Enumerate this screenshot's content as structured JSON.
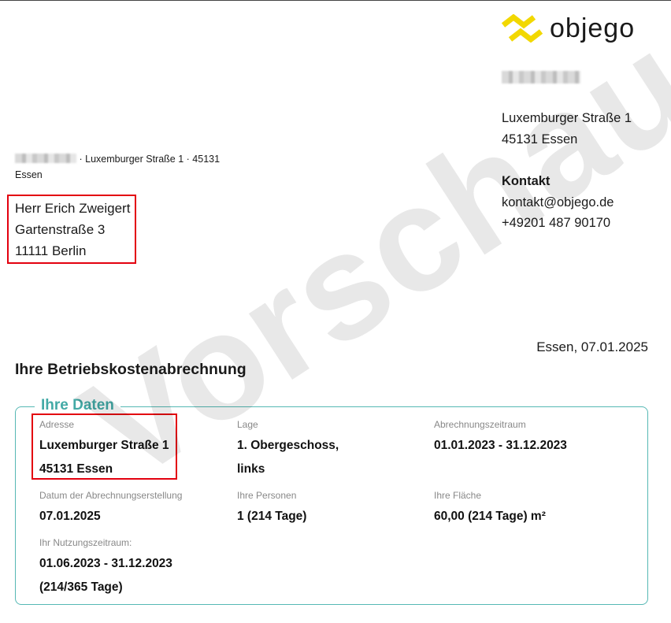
{
  "logo": {
    "text": "objego",
    "color": "#f2d800"
  },
  "sender": {
    "street": "Luxemburger Straße 1",
    "city": "45131 Essen",
    "contact_heading": "Kontakt",
    "email": "kontakt@objego.de",
    "phone": "+49201 487 90170"
  },
  "return_address": {
    "text": "· Luxemburger Straße 1 · 45131",
    "city": "Essen"
  },
  "recipient": {
    "name": "Herr Erich Zweigert",
    "street": "Gartenstraße 3",
    "city": "11111 Berlin"
  },
  "date_line": "Essen, 07.01.2025",
  "title": "Ihre Betriebskostenabrechnung",
  "panel": {
    "title": "Ihre Daten",
    "accent_color": "#43aaa6",
    "fields": {
      "address": {
        "label": "Adresse",
        "line1": "Luxemburger Straße 1",
        "line2": "45131 Essen"
      },
      "location": {
        "label": "Lage",
        "line1": "1. Obergeschoss,",
        "line2": "links"
      },
      "period": {
        "label": "Abrechnungszeitraum",
        "line1": "01.01.2023 - 31.12.2023"
      },
      "created": {
        "label": "Datum der Abrechnungserstellung",
        "line1": "07.01.2025"
      },
      "persons": {
        "label": "Ihre Personen",
        "line1": "1 (214 Tage)"
      },
      "area": {
        "label": "Ihre Fläche",
        "line1": "60,00 (214 Tage) m²"
      },
      "usage": {
        "label": "Ihr Nutzungszeitraum:",
        "line1": "01.06.2023 - 31.12.2023",
        "line2": "(214/365 Tage)"
      }
    }
  },
  "watermark": "Vorschau",
  "highlight_color": "#e3000f"
}
